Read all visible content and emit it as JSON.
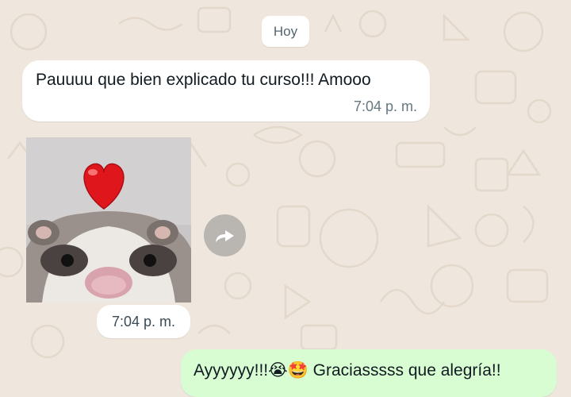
{
  "chat": {
    "date_label": "Hoy",
    "messages": [
      {
        "text": "Pauuuu que bien explicado tu curso!!! Amooo",
        "time": "7:04 p. m."
      },
      {
        "sticker": "heart-ferret-sticker",
        "time": "7:04 p. m."
      },
      {
        "text": "Ayyyyyy!!!😭🤩 Graciasssss que alegría!!"
      }
    ]
  },
  "colors": {
    "wallpaper": "#efe7dd",
    "incoming_bubble": "#ffffff",
    "outgoing_bubble": "#d9fdd3"
  }
}
